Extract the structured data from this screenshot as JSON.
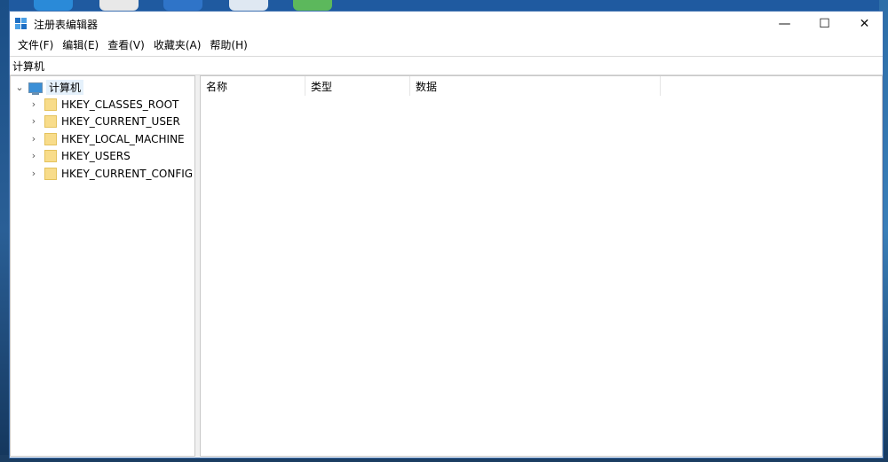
{
  "window": {
    "title": "注册表编辑器",
    "controls": {
      "minimize": "—",
      "maximize": "☐",
      "close": "✕"
    }
  },
  "menu": {
    "items": [
      {
        "label": "文件(F)"
      },
      {
        "label": "编辑(E)"
      },
      {
        "label": "查看(V)"
      },
      {
        "label": "收藏夹(A)"
      },
      {
        "label": "帮助(H)"
      }
    ]
  },
  "address": {
    "path": "计算机"
  },
  "tree": {
    "root": {
      "label": "计算机",
      "icon": "computer-icon"
    },
    "children": [
      {
        "label": "HKEY_CLASSES_ROOT",
        "icon": "folder-icon"
      },
      {
        "label": "HKEY_CURRENT_USER",
        "icon": "folder-icon"
      },
      {
        "label": "HKEY_LOCAL_MACHINE",
        "icon": "folder-icon"
      },
      {
        "label": "HKEY_USERS",
        "icon": "folder-icon"
      },
      {
        "label": "HKEY_CURRENT_CONFIG",
        "icon": "folder-icon"
      }
    ]
  },
  "list": {
    "columns": [
      {
        "label": "名称"
      },
      {
        "label": "类型"
      },
      {
        "label": "数据"
      }
    ]
  }
}
